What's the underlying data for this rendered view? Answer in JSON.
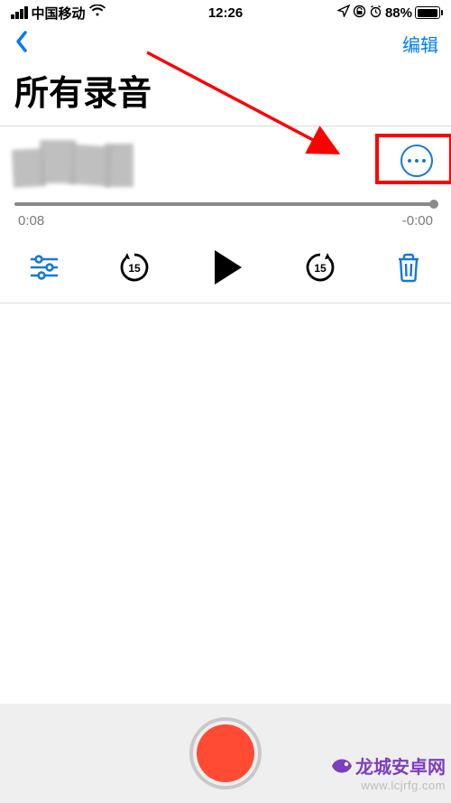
{
  "status": {
    "carrier": "中国移动",
    "time": "12:26",
    "battery_pct": "88%"
  },
  "nav": {
    "edit": "编辑"
  },
  "title": "所有录音",
  "player": {
    "elapsed": "0:08",
    "remaining": "-0:00"
  },
  "icons": {
    "back": "chevron-left",
    "wifi": "wifi",
    "location": "location",
    "alarm": "alarm",
    "more": "more",
    "sliders": "sliders",
    "rewind15": "rewind-15",
    "play": "play",
    "forward15": "forward-15",
    "trash": "trash"
  },
  "watermark": {
    "brand": "龙城安卓网",
    "url": "www.lcjrfg.com"
  }
}
